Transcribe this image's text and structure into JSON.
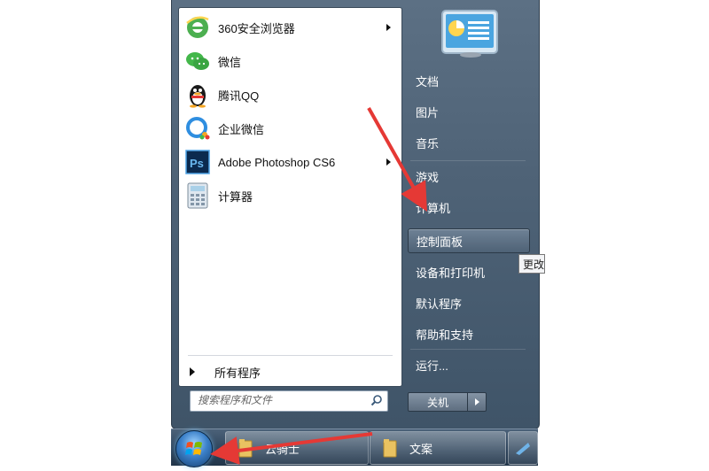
{
  "start_menu": {
    "programs": [
      {
        "label": "360安全浏览器",
        "icon": "ie-browser-icon",
        "has_submenu": true
      },
      {
        "label": "微信",
        "icon": "wechat-icon",
        "has_submenu": false
      },
      {
        "label": "腾讯QQ",
        "icon": "qq-penguin-icon",
        "has_submenu": false
      },
      {
        "label": "企业微信",
        "icon": "wecom-icon",
        "has_submenu": false
      },
      {
        "label": "Adobe Photoshop CS6",
        "icon": "photoshop-icon",
        "has_submenu": true
      },
      {
        "label": "计算器",
        "icon": "calculator-icon",
        "has_submenu": false
      }
    ],
    "all_programs_label": "所有程序",
    "search_placeholder": "搜索程序和文件",
    "right_items": [
      {
        "label": "文档"
      },
      {
        "label": "图片"
      },
      {
        "label": "音乐"
      },
      {
        "label": "游戏"
      },
      {
        "label": "计算机"
      },
      {
        "label": "控制面板",
        "highlighted": true
      },
      {
        "label": "设备和打印机"
      },
      {
        "label": "默认程序"
      },
      {
        "label": "帮助和支持"
      },
      {
        "label": "运行..."
      }
    ],
    "tooltip": "更改",
    "shutdown_label": "关机"
  },
  "taskbar": {
    "items": [
      {
        "label": "云骑士",
        "icon": "folder-icon"
      },
      {
        "label": "文案",
        "icon": "folder-icon"
      }
    ]
  },
  "colors": {
    "accent_arrow": "#e53935",
    "menu_panel": "#4f6377"
  }
}
